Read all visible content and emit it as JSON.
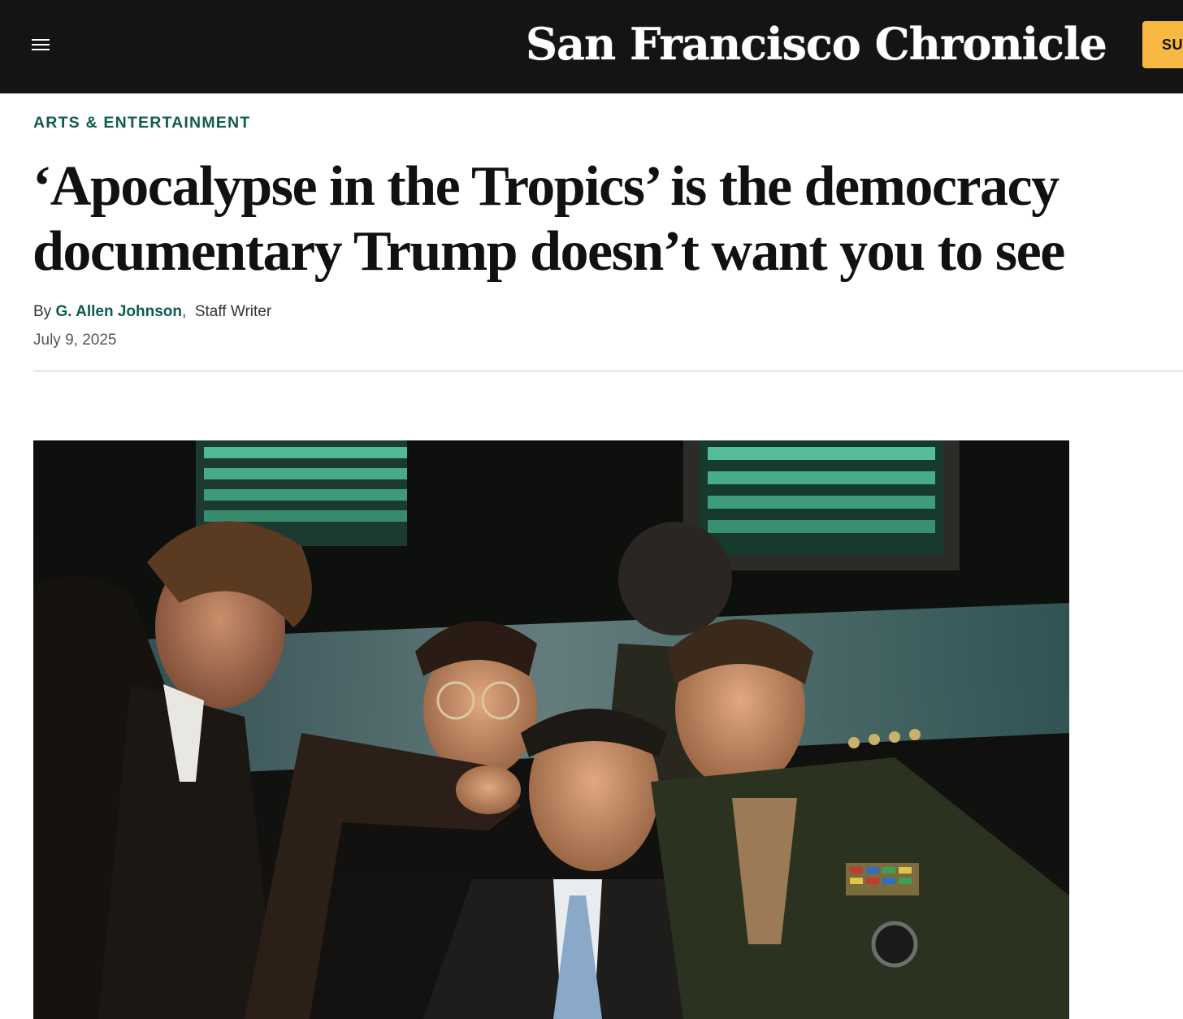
{
  "header": {
    "brand": "San Francisco Chronicle",
    "subscribe_label": "SU",
    "menu_icon": "hamburger-menu-icon",
    "background": "#141414",
    "subscribe_color": "#f7b941"
  },
  "article": {
    "section": "ARTS & ENTERTAINMENT",
    "headline_lines": [
      "‘Apocalypse in the Tropics’ is the democracy",
      "documentary Trump doesn’t want you to see"
    ],
    "byline_prefix": "By",
    "author": "G. Allen Johnson",
    "separator": ",",
    "role": "Staff Writer",
    "date": "July 9, 2025",
    "accent_color": "#0f5c4f"
  }
}
